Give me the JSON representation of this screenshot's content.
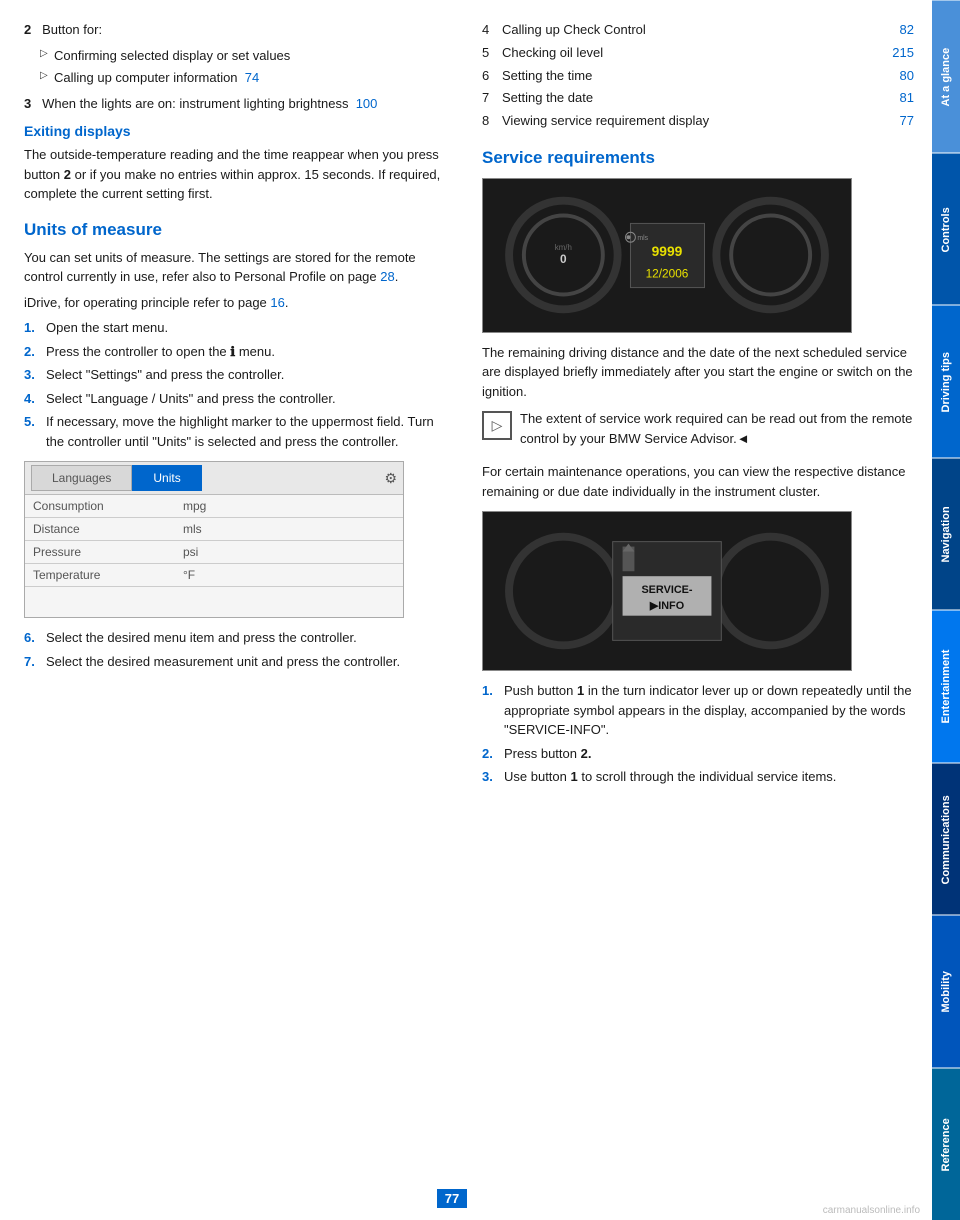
{
  "page": {
    "number": "77"
  },
  "sidebar": {
    "tabs": [
      {
        "label": "At a glance",
        "active": false
      },
      {
        "label": "Controls",
        "active": true
      },
      {
        "label": "Driving tips",
        "active": false
      },
      {
        "label": "Navigation",
        "active": false
      },
      {
        "label": "Entertainment",
        "active": false
      },
      {
        "label": "Communications",
        "active": false
      },
      {
        "label": "Mobility",
        "active": false
      },
      {
        "label": "Reference",
        "active": false
      }
    ]
  },
  "left": {
    "button2_label": "2",
    "button2_intro": "Button for:",
    "bullet1": "Confirming selected display or set values",
    "bullet2": "Calling up computer information",
    "bullet2_link": "74",
    "button3_label": "3",
    "button3_text": "When the lights are on: instrument lighting brightness",
    "button3_link": "100",
    "exiting_title": "Exiting displays",
    "exiting_text1": "The outside-temperature reading and the time reappear when you press button",
    "exiting_bold": "2",
    "exiting_text2": "or if you make no entries within approx. 15 seconds. If required, complete the current setting first.",
    "units_title": "Units of measure",
    "units_text1": "You can set units of measure. The settings are stored for the remote control currently in use, refer also to Personal Profile on page",
    "units_link1": "28",
    "units_text2": "iDrive, for operating principle refer to page",
    "units_link2": "16",
    "steps": [
      {
        "num": "1.",
        "text": "Open the start menu."
      },
      {
        "num": "2.",
        "text": "Press the controller to open the"
      },
      {
        "num": "3.",
        "text": "Select \"Settings\" and press the controller."
      },
      {
        "num": "4.",
        "text": "Select \"Language / Units\" and press the controller."
      },
      {
        "num": "5.",
        "text": "If necessary, move the highlight marker to the uppermost field. Turn the controller until \"Units\" is selected and press the controller."
      }
    ],
    "step2_icon": "ℹ",
    "step2_suffix": "menu.",
    "table": {
      "tabs": [
        {
          "label": "Languages",
          "active": false
        },
        {
          "label": "Units",
          "active": true
        }
      ],
      "rows": [
        {
          "label": "Consumption",
          "value": "mpg"
        },
        {
          "label": "Distance",
          "value": "mls"
        },
        {
          "label": "Pressure",
          "value": "psi"
        },
        {
          "label": "Temperature",
          "value": "°F"
        }
      ]
    },
    "steps2": [
      {
        "num": "6.",
        "text": "Select the desired menu item and press the controller."
      },
      {
        "num": "7.",
        "text": "Select the desired measurement unit and press the controller."
      }
    ]
  },
  "right": {
    "list_items": [
      {
        "num": "4",
        "text": "Calling up Check Control",
        "link": "82"
      },
      {
        "num": "5",
        "text": "Checking oil level",
        "link": "215"
      },
      {
        "num": "6",
        "text": "Setting the time",
        "link": "80"
      },
      {
        "num": "7",
        "text": "Setting the date",
        "link": "81"
      },
      {
        "num": "8",
        "text": "Viewing service requirement display",
        "link": "77"
      }
    ],
    "service_title": "Service requirements",
    "dash_mils": "mls",
    "dash_value": "9999",
    "dash_date": "12/2006",
    "service_caption": "The remaining driving distance and the date of the next scheduled service are displayed briefly immediately after you start the engine or switch on the ignition.",
    "note_text": "The extent of service work required can be read out from the remote control by your BMW Service Advisor.◄",
    "maintenance_text": "For certain maintenance operations, you can view the respective distance remaining or due date individually in the instrument cluster.",
    "service_label": "SERVICE-\n▶INFO",
    "service_steps": [
      {
        "num": "1.",
        "text": "Push button",
        "bold": "1",
        "text2": "in the turn indicator lever up or down repeatedly until the appropriate symbol appears in the display, accompanied by the words \"SERVICE-INFO\"."
      },
      {
        "num": "2.",
        "text": "Press button",
        "bold": "2."
      },
      {
        "num": "3.",
        "text": "Use button",
        "bold": "1",
        "text2": "to scroll through the individual service items."
      }
    ]
  }
}
